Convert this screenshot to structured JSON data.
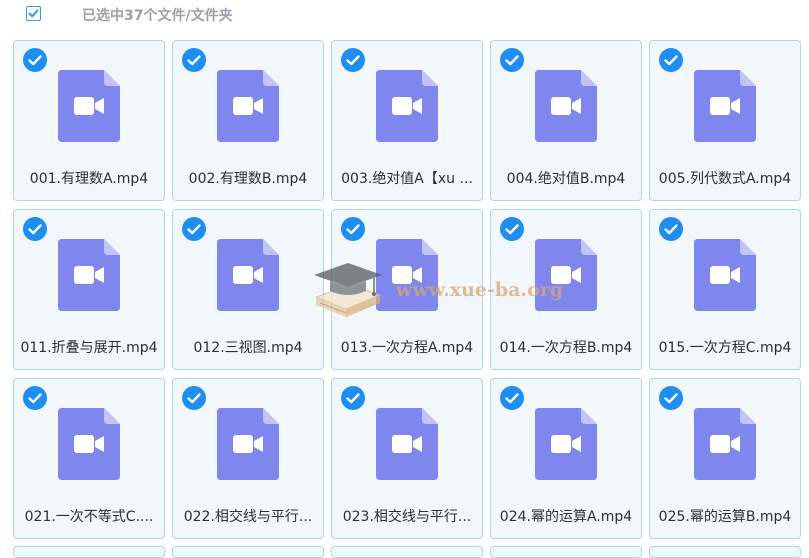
{
  "header": {
    "select_all_checked": true,
    "selected_text": "已选中37个文件/文件夹"
  },
  "colors": {
    "accent": "#1e8ef2",
    "file_icon": "#7f86ee",
    "card_bg": "#f1f7fb",
    "card_border": "#a9d8ef"
  },
  "files": [
    {
      "name": "001.有理数A.mp4",
      "selected": true,
      "icon": "video-file-icon"
    },
    {
      "name": "002.有理数B.mp4",
      "selected": true,
      "icon": "video-file-icon"
    },
    {
      "name": "003.绝对值A【xu ...",
      "selected": true,
      "icon": "video-file-icon"
    },
    {
      "name": "004.绝对值B.mp4",
      "selected": true,
      "icon": "video-file-icon"
    },
    {
      "name": "005.列代数式A.mp4",
      "selected": true,
      "icon": "video-file-icon"
    },
    {
      "name": "011.折叠与展开.mp4",
      "selected": true,
      "icon": "video-file-icon"
    },
    {
      "name": "012.三视图.mp4",
      "selected": true,
      "icon": "video-file-icon"
    },
    {
      "name": "013.一次方程A.mp4",
      "selected": true,
      "icon": "video-file-icon"
    },
    {
      "name": "014.一次方程B.mp4",
      "selected": true,
      "icon": "video-file-icon"
    },
    {
      "name": "015.一次方程C.mp4",
      "selected": true,
      "icon": "video-file-icon"
    },
    {
      "name": "021.一次不等式C....",
      "selected": true,
      "icon": "video-file-icon"
    },
    {
      "name": "022.相交线与平行...",
      "selected": true,
      "icon": "video-file-icon"
    },
    {
      "name": "023.相交线与平行...",
      "selected": true,
      "icon": "video-file-icon"
    },
    {
      "name": "024.幂的运算A.mp4",
      "selected": true,
      "icon": "video-file-icon"
    },
    {
      "name": "025.幂的运算B.mp4",
      "selected": true,
      "icon": "video-file-icon"
    }
  ],
  "watermark": {
    "text": "www.xue-ba.org",
    "icon": "graduation-cap-books-icon"
  }
}
